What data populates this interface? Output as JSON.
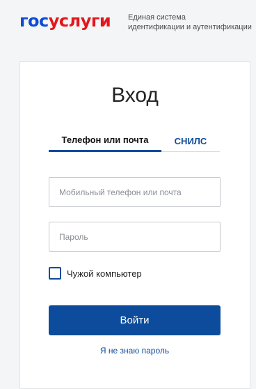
{
  "header": {
    "logo_part1": "гос",
    "logo_part2": "услуги",
    "tagline_line1": "Единая система",
    "tagline_line2": "идентификации и аутентификации"
  },
  "login": {
    "title": "Вход",
    "tabs": [
      {
        "label": "Телефон или почта",
        "active": true
      },
      {
        "label": "СНИЛС",
        "active": false
      }
    ],
    "phone_placeholder": "Мобильный телефон или почта",
    "password_placeholder": "Пароль",
    "checkbox_label": "Чужой компьютер",
    "submit_label": "Войти",
    "forgot_link": "Я не знаю пароль"
  },
  "colors": {
    "brand_blue": "#0d4cd3",
    "brand_red": "#e4161d",
    "primary": "#0d4c9c"
  }
}
